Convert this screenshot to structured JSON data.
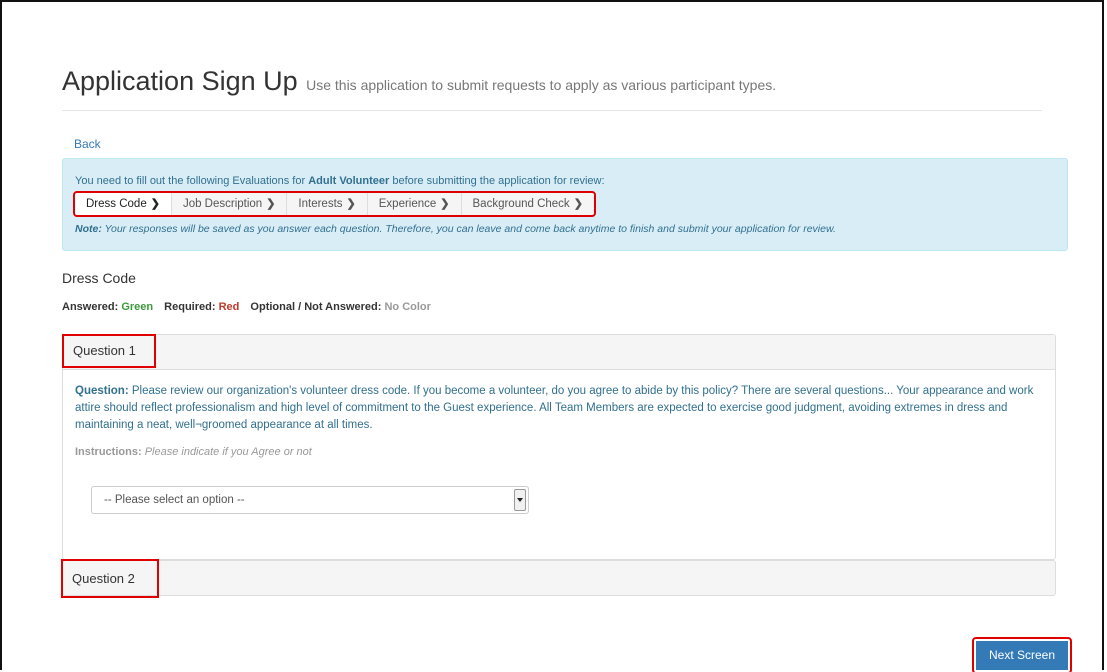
{
  "header": {
    "title": "Application Sign Up",
    "subtitle": "Use this application to submit requests to apply as various participant types."
  },
  "back_label": "Back",
  "info": {
    "intro_prefix": "You need to fill out the following Evaluations for ",
    "role": "Adult Volunteer",
    "intro_suffix": " before submitting the application for review:",
    "steps": [
      {
        "label": "Dress Code"
      },
      {
        "label": "Job Description"
      },
      {
        "label": "Interests"
      },
      {
        "label": "Experience"
      },
      {
        "label": "Background Check"
      }
    ],
    "note_label": "Note:",
    "note_text": " Your responses will be saved as you answer each question. Therefore, you can leave and come back anytime to finish and submit your application for review."
  },
  "section_title": "Dress Code",
  "legend": {
    "answered_label": "Answered:",
    "answered_value": "Green",
    "required_label": "Required:",
    "required_value": "Red",
    "optional_label": "Optional / Not Answered:",
    "optional_value": "No Color"
  },
  "question1": {
    "label": "Question 1",
    "question_label": "Question:",
    "question_text": " Please review our organization's volunteer dress code. If you become a volunteer, do you agree to abide by this policy? There are several questions... Your appearance and work attire should reflect professionalism and high level of commitment to the Guest experience. All Team Members are expected to exercise good judgment, avoiding extremes in dress and maintaining a neat, well¬groomed appearance at all times.",
    "instructions_label": "Instructions:",
    "instructions_text": "Please indicate if you Agree or not",
    "select_value": "-- Please select an option --"
  },
  "question2": {
    "label": "Question 2"
  },
  "next_button": "Next Screen",
  "colors": {
    "accent": "#337ab7",
    "info_bg": "#d9edf7",
    "highlight": "#e00000",
    "green": "#3c9a3c",
    "red": "#c0392b"
  }
}
